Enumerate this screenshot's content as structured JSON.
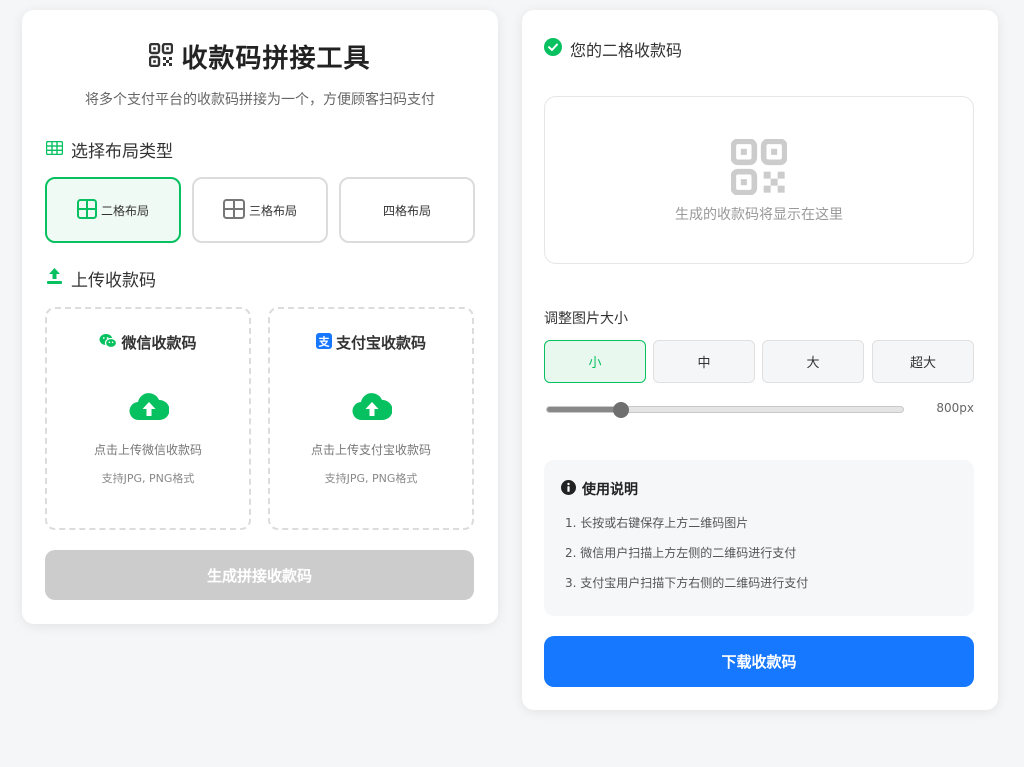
{
  "app": {
    "title": "收款码拼接工具",
    "subtitle": "将多个支付平台的收款码拼接为一个，方便顾客扫码支付"
  },
  "layout_section": {
    "heading": "选择布局类型",
    "options": [
      {
        "label": "二格布局",
        "selected": true
      },
      {
        "label": "三格布局",
        "selected": false
      },
      {
        "label": "四格布局",
        "selected": false
      }
    ]
  },
  "upload_section": {
    "heading": "上传收款码",
    "boxes": [
      {
        "title": "微信收款码",
        "hint": "点击上传微信收款码",
        "format": "支持JPG, PNG格式",
        "icon": "wechat-icon"
      },
      {
        "title": "支付宝收款码",
        "hint": "点击上传支付宝收款码",
        "format": "支持JPG, PNG格式",
        "icon": "alipay-icon"
      }
    ],
    "generate_label": "生成拼接收款码"
  },
  "result": {
    "title": "您的二格收款码",
    "placeholder": "生成的收款码将显示在这里"
  },
  "size": {
    "label": "调整图片大小",
    "options": [
      {
        "label": "小",
        "selected": true
      },
      {
        "label": "中",
        "selected": false
      },
      {
        "label": "大",
        "selected": false
      },
      {
        "label": "超大",
        "selected": false
      }
    ],
    "slider_fraction": 0.21,
    "value_text": "800px"
  },
  "guide": {
    "title": "使用说明",
    "items": [
      "1. 长按或右键保存上方二维码图片",
      "2. 微信用户扫描上方左侧的二维码进行支付",
      "3. 支付宝用户扫描下方右侧的二维码进行支付"
    ]
  },
  "download_label": "下载收款码",
  "colors": {
    "accent_green": "#07c160",
    "accent_blue": "#1677ff",
    "disabled_gray": "#cccccc"
  }
}
